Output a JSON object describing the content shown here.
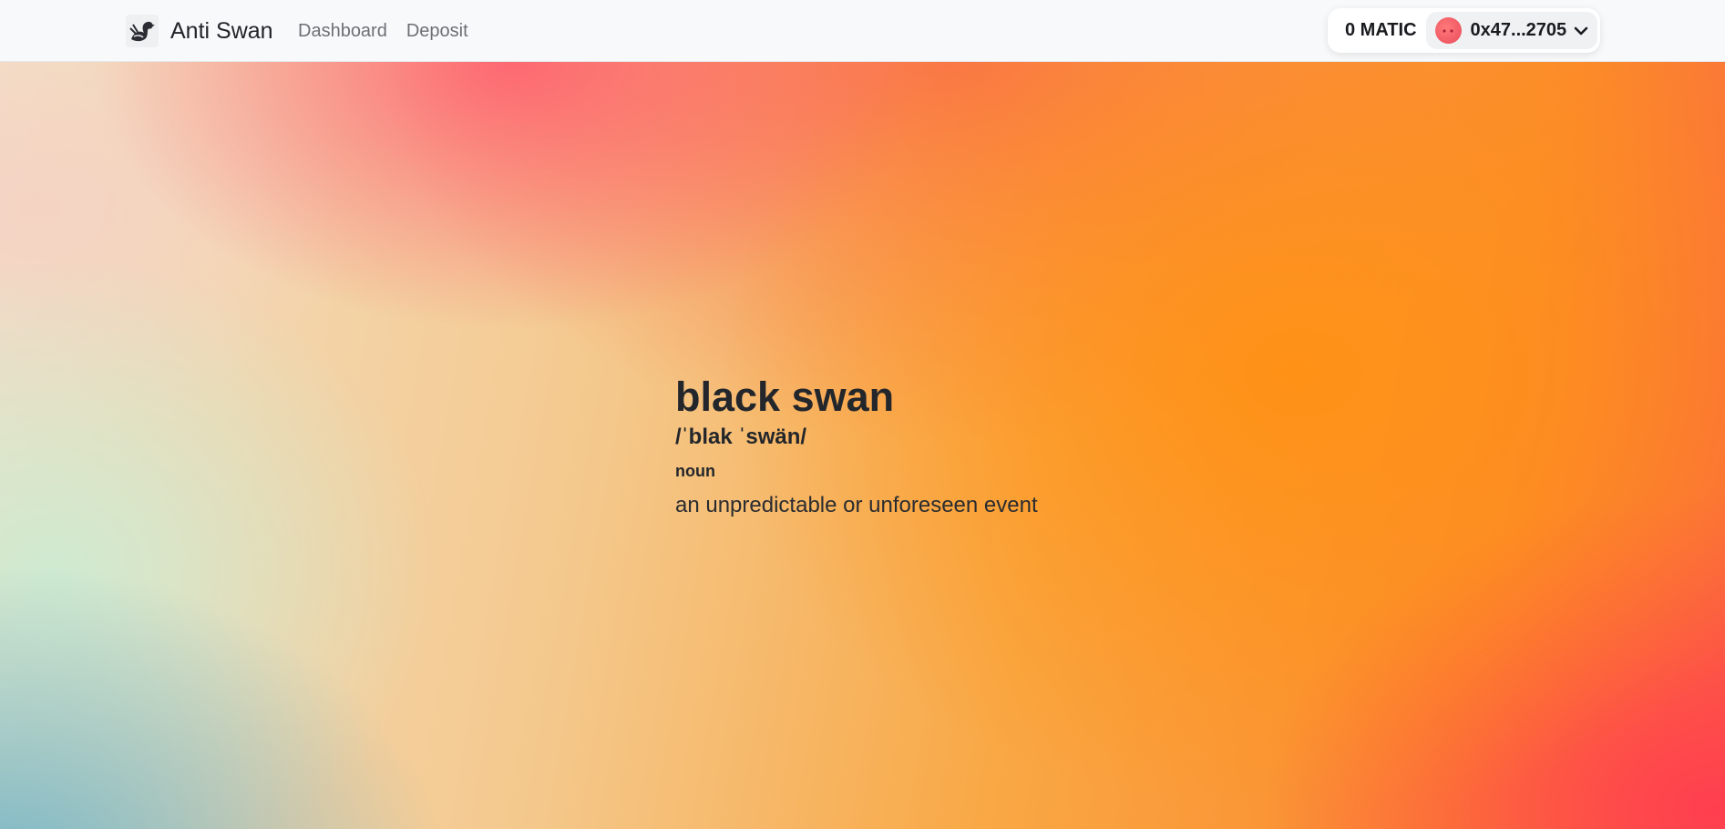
{
  "nav": {
    "brand": "Anti Swan",
    "links": [
      "Dashboard",
      "Deposit"
    ]
  },
  "wallet": {
    "balance": "0 MATIC",
    "address": "0x47...2705"
  },
  "hero": {
    "term": "black swan",
    "pronunciation": "/ˈblak ˈswän/",
    "part_of_speech": "noun",
    "definition": "an unpredictable or unforeseen event"
  },
  "icons": {
    "brand_logo": "swan-logo-icon",
    "avatar": "avatar-icon",
    "chevron": "chevron-down-icon"
  },
  "colors": {
    "navbar_bg": "#f8f9fa",
    "text": "#212529",
    "nav_link": "#6c7074",
    "gradient_orange": "#fb8a2c",
    "gradient_red": "#ff3c50",
    "gradient_teal": "#6eb4c8"
  }
}
